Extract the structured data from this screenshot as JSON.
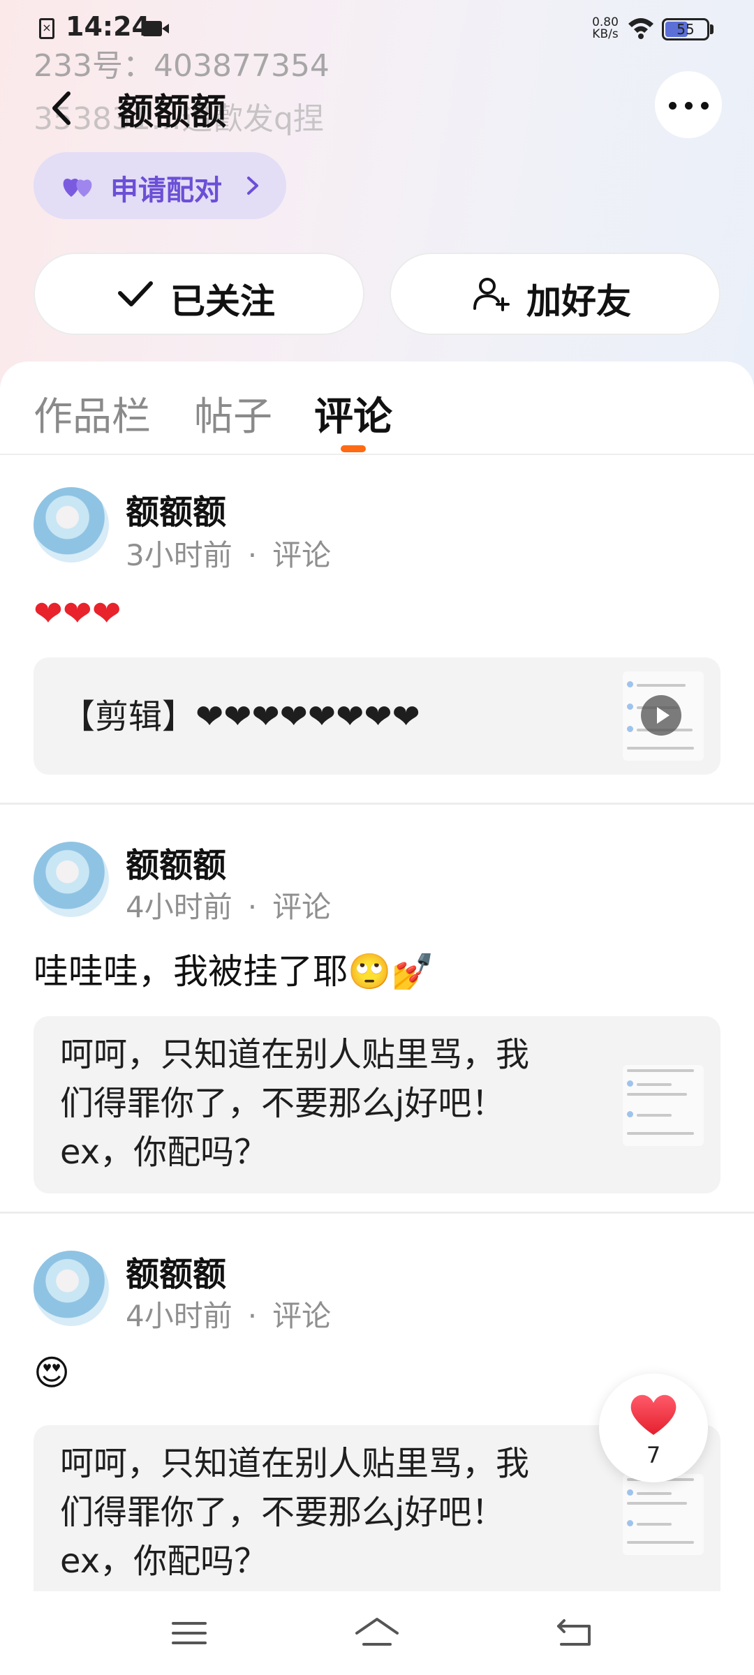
{
  "status_bar": {
    "time": "14:24",
    "net_speed_value": "0.80",
    "net_speed_unit": "KB/s",
    "battery": "55"
  },
  "profile_bg": {
    "id_line": "233号：403877354",
    "bio_line": "353831…追歡发q捏"
  },
  "header": {
    "title": "额额额"
  },
  "pair_button": {
    "label": "申请配对"
  },
  "actions": {
    "follow_label": "已关注",
    "add_friend_label": "加好友"
  },
  "tabs": [
    {
      "label": "作品栏",
      "active": false
    },
    {
      "label": "帖子",
      "active": false
    },
    {
      "label": "评论",
      "active": true
    }
  ],
  "posts": [
    {
      "author": "额额额",
      "time": "3小时前",
      "type": "评论",
      "text": "❤❤❤",
      "quote": {
        "text": "【剪辑】❤❤❤❤❤❤❤❤",
        "has_video": true
      }
    },
    {
      "author": "额额额",
      "time": "4小时前",
      "type": "评论",
      "text": "哇哇哇，我被挂了耶🙄💅",
      "quote": {
        "lines": [
          "呵呵，只知道在别人贴里骂，我",
          "们得罪你了，不要那么j好吧！",
          "ex，你配吗？"
        ]
      }
    },
    {
      "author": "额额额",
      "time": "4小时前",
      "type": "评论",
      "text": "😍",
      "quote": {
        "lines": [
          "呵呵，只知道在别人贴里骂，我",
          "们得罪你了，不要那么j好吧！",
          "ex，你配吗？"
        ]
      }
    }
  ],
  "like_fab": {
    "count": "7"
  },
  "colors": {
    "accent": "#ff6a13",
    "pair_bg": "#e3ddf6",
    "pair_text": "#6b4fd6",
    "heart": "#e8232c"
  }
}
